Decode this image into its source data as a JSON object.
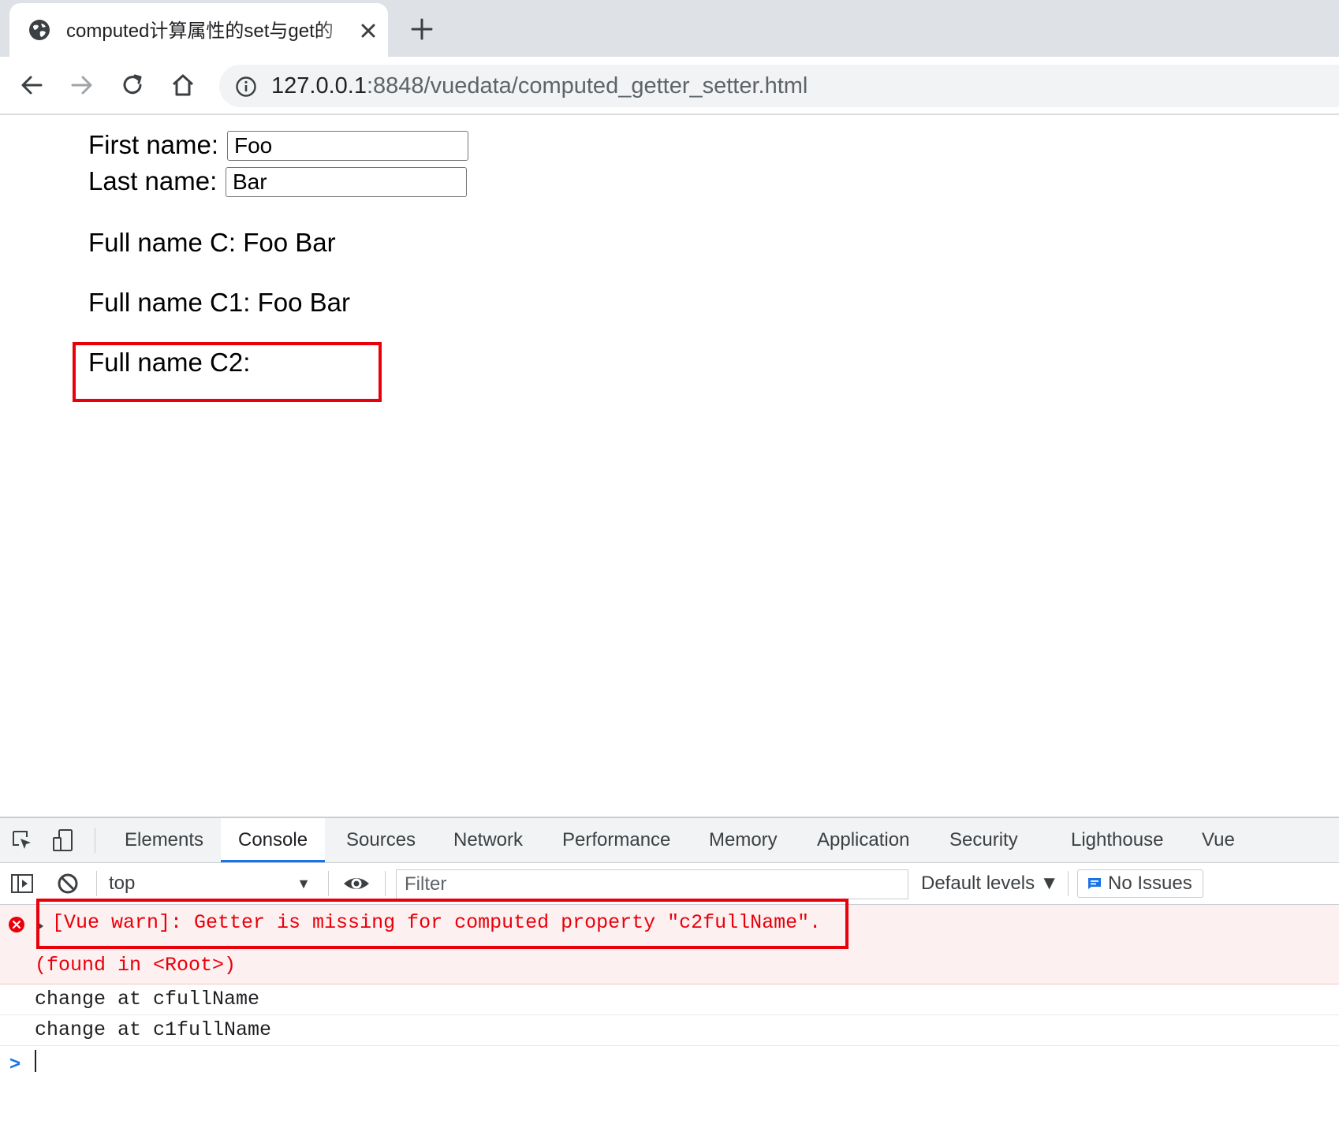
{
  "browser": {
    "tab_title": "computed计算属性的set与get的",
    "tab_icon": "globe-icon",
    "url_host": "127.0.0.1",
    "url_rest": ":8848/vuedata/computed_getter_setter.html"
  },
  "page": {
    "first_label": "First name:",
    "first_value": "Foo",
    "last_label": "Last name:",
    "last_value": "Bar",
    "full_c": "Full name C: Foo Bar",
    "full_c1": "Full name C1: Foo Bar",
    "full_c2": "Full name C2:"
  },
  "devtools": {
    "tabs": [
      "Elements",
      "Console",
      "Sources",
      "Network",
      "Performance",
      "Memory",
      "Application",
      "Security",
      "Lighthouse",
      "Vue"
    ],
    "active_tab": "Console",
    "context": "top",
    "filter_placeholder": "Filter",
    "levels": "Default levels ▼",
    "issues": "No Issues",
    "messages": {
      "error_line1": "[Vue warn]: Getter is missing for computed property \"c2fullName\".",
      "error_line2": "(found in <Root>)",
      "log1": "change at cfullName",
      "log2": "change at c1fullName"
    },
    "prompt": ">"
  },
  "colors": {
    "highlight": "#e8000b",
    "accent": "#1a73e8",
    "error_bg": "#fdf0f0"
  }
}
